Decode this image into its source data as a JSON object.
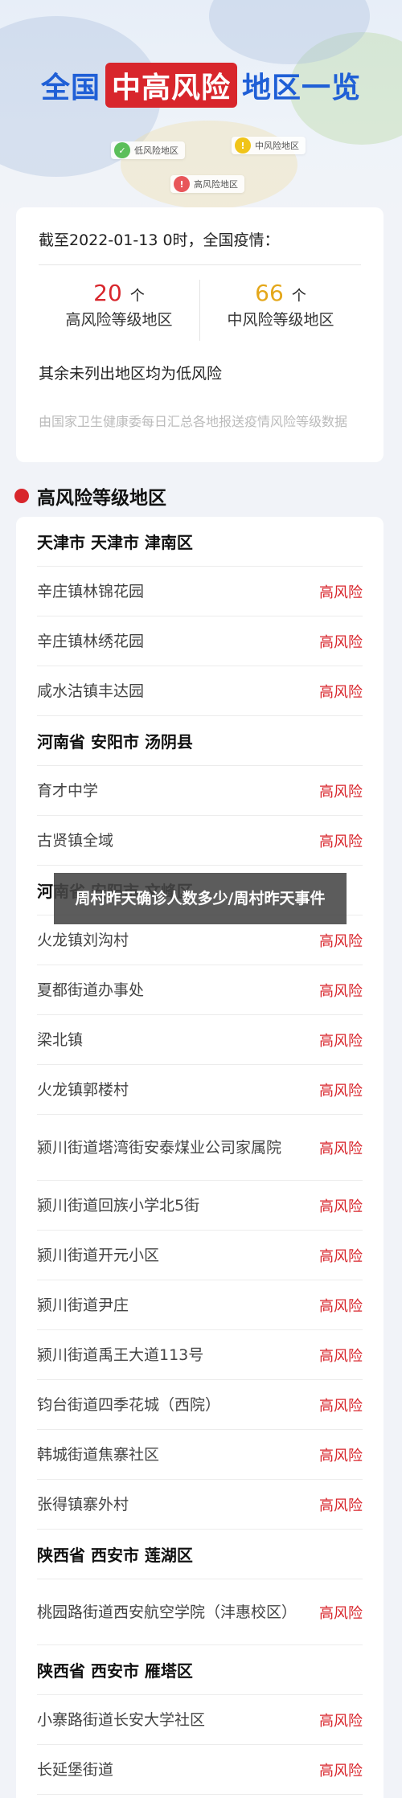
{
  "header": {
    "title_prefix": "全国",
    "title_highlight": "中高风险",
    "title_suffix": "地区一览",
    "legend": {
      "low": {
        "label": "低风险地区",
        "color": "#5bbf5a",
        "icon": "check-icon"
      },
      "mid": {
        "label": "中风险地区",
        "color": "#f0c419",
        "icon": "exclamation-icon"
      },
      "high": {
        "label": "高风险地区",
        "color": "#e8565a",
        "icon": "exclamation-icon"
      }
    }
  },
  "summary": {
    "as_of": "截至2022-01-13 0时，全国疫情：",
    "high": {
      "count": "20",
      "unit": "个",
      "label": "高风险等级地区",
      "color": "#d8262c"
    },
    "mid": {
      "count": "66",
      "unit": "个",
      "label": "中风险等级地区",
      "color": "#e4a71a"
    },
    "note": "其余未列出地区均为低风险",
    "source": "由国家卫生健康委每日汇总各地报送疫情风险等级数据"
  },
  "section": {
    "title": "高风险等级地区",
    "bullet_color": "#d8262c"
  },
  "rows": [
    {
      "type": "region",
      "text": "天津市 天津市 津南区"
    },
    {
      "type": "place",
      "text": "辛庄镇林锦花园",
      "risk": "高风险"
    },
    {
      "type": "place",
      "text": "辛庄镇林绣花园",
      "risk": "高风险"
    },
    {
      "type": "place",
      "text": "咸水沽镇丰达园",
      "risk": "高风险"
    },
    {
      "type": "region",
      "text": "河南省 安阳市 汤阴县"
    },
    {
      "type": "place",
      "text": "育才中学",
      "risk": "高风险"
    },
    {
      "type": "place",
      "text": "古贤镇全域",
      "risk": "高风险"
    },
    {
      "type": "region",
      "text": "河南省 安阳市 文峰区"
    },
    {
      "type": "place",
      "text": "火龙镇刘沟村",
      "risk": "高风险"
    },
    {
      "type": "place",
      "text": "夏都街道办事处",
      "risk": "高风险"
    },
    {
      "type": "place",
      "text": "梁北镇",
      "risk": "高风险"
    },
    {
      "type": "place",
      "text": "火龙镇郭楼村",
      "risk": "高风险"
    },
    {
      "type": "place",
      "text": "颍川街道塔湾街安泰煤业公司家属院",
      "risk": "高风险"
    },
    {
      "type": "place",
      "text": "颍川街道回族小学北5街",
      "risk": "高风险"
    },
    {
      "type": "place",
      "text": "颍川街道开元小区",
      "risk": "高风险"
    },
    {
      "type": "place",
      "text": "颍川街道尹庄",
      "risk": "高风险"
    },
    {
      "type": "place",
      "text": "颍川街道禹王大道113号",
      "risk": "高风险"
    },
    {
      "type": "place",
      "text": "钧台街道四季花城（西院）",
      "risk": "高风险"
    },
    {
      "type": "place",
      "text": "韩城街道焦寨社区",
      "risk": "高风险"
    },
    {
      "type": "place",
      "text": "张得镇寨外村",
      "risk": "高风险"
    },
    {
      "type": "region",
      "text": "陕西省 西安市 莲湖区"
    },
    {
      "type": "place",
      "text": "桃园路街道西安航空学院（沣惠校区）",
      "risk": "高风险"
    },
    {
      "type": "region",
      "text": "陕西省 西安市 雁塔区"
    },
    {
      "type": "place",
      "text": "小寨路街道长安大学社区",
      "risk": "高风险"
    },
    {
      "type": "place",
      "text": "长延堡街道",
      "risk": "高风险"
    }
  ],
  "overlay": {
    "text": "周村昨天确诊人数多少/周村昨天事件"
  }
}
